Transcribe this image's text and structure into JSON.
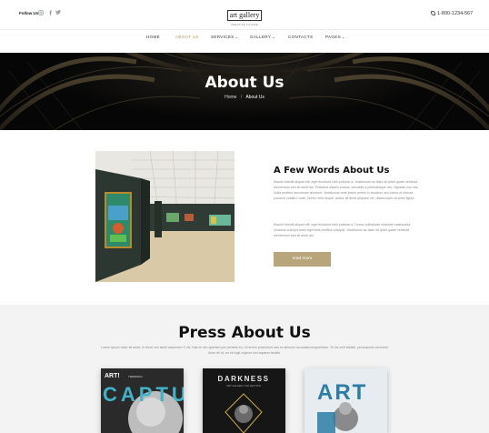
{
  "header": {
    "follow_label": "Follow Us",
    "social_icons": [
      "instagram-icon",
      "facebook-icon",
      "twitter-icon"
    ],
    "logo_text": "art gallery",
    "logo_sub": "CREATIVE FUTURE",
    "phone": "1-800-1234-567"
  },
  "nav": [
    {
      "label": "HOME",
      "dropdown": false
    },
    {
      "label": "ABOUT US",
      "dropdown": false,
      "active": true
    },
    {
      "label": "SERVICES",
      "dropdown": true
    },
    {
      "label": "GALLERY",
      "dropdown": true
    },
    {
      "label": "CONTACTS",
      "dropdown": false
    },
    {
      "label": "PAGES",
      "dropdown": true
    }
  ],
  "hero": {
    "title": "About Us",
    "breadcrumb": {
      "home": "Home",
      "separator": "/",
      "current": "About Us"
    }
  },
  "words": {
    "title": "A Few Words About Us",
    "para1": "Mauris blandit aliquet elit, eget tincidunt nibh pulvinar a. Vestibulum ac diam sit amet quam vehicula elementum sed sit amet dui. Praesent sapien massa, convallis a pellentesque nec, egestas non nisi. Nulla porttitor accumsan tincidunt. Vestibulum ante ipsum primis in faucibus orci luctus et ultrices posuere cubilia Curae; Donec velit neque, auctor sit amet aliquam vel, ullamcorper sit amet ligula.",
    "para2": "Mauris blandit aliquet elit, eget tincidunt nibh pulvinar a. Donec sollicitudin molestie malesuada. Vivamus suscipit tortor eget felis porttitor volutpat. Vestibulum ac diam sit amet quam vehicula elementum sed sit amet dui.",
    "button": "read more"
  },
  "press": {
    "title": "Press About Us",
    "text": "Lorem ipsum dolor sit amet, In dicat non simili assumere S vis. Has te nec aperiam per pertaris eu, mi errem phaedrum has ex alienum accusata eloquentiam. Te ius velit fastidii, persequeris ocurreret iriure eti ut, an sit fugit regione nisi sapiens facilisi."
  },
  "covers": [
    {
      "top_label": "ART!",
      "side_label": "TRENDING",
      "big_text": "CAPTUR"
    },
    {
      "top_label": "DARKNESS",
      "sub_label": "ART GALLERY COLLECTION"
    },
    {
      "big_text": "ART"
    }
  ],
  "colors": {
    "accent": "#b39858",
    "button": "#b8a57b",
    "hero_bg": "#111111",
    "press_bg": "#f3f3f3"
  }
}
